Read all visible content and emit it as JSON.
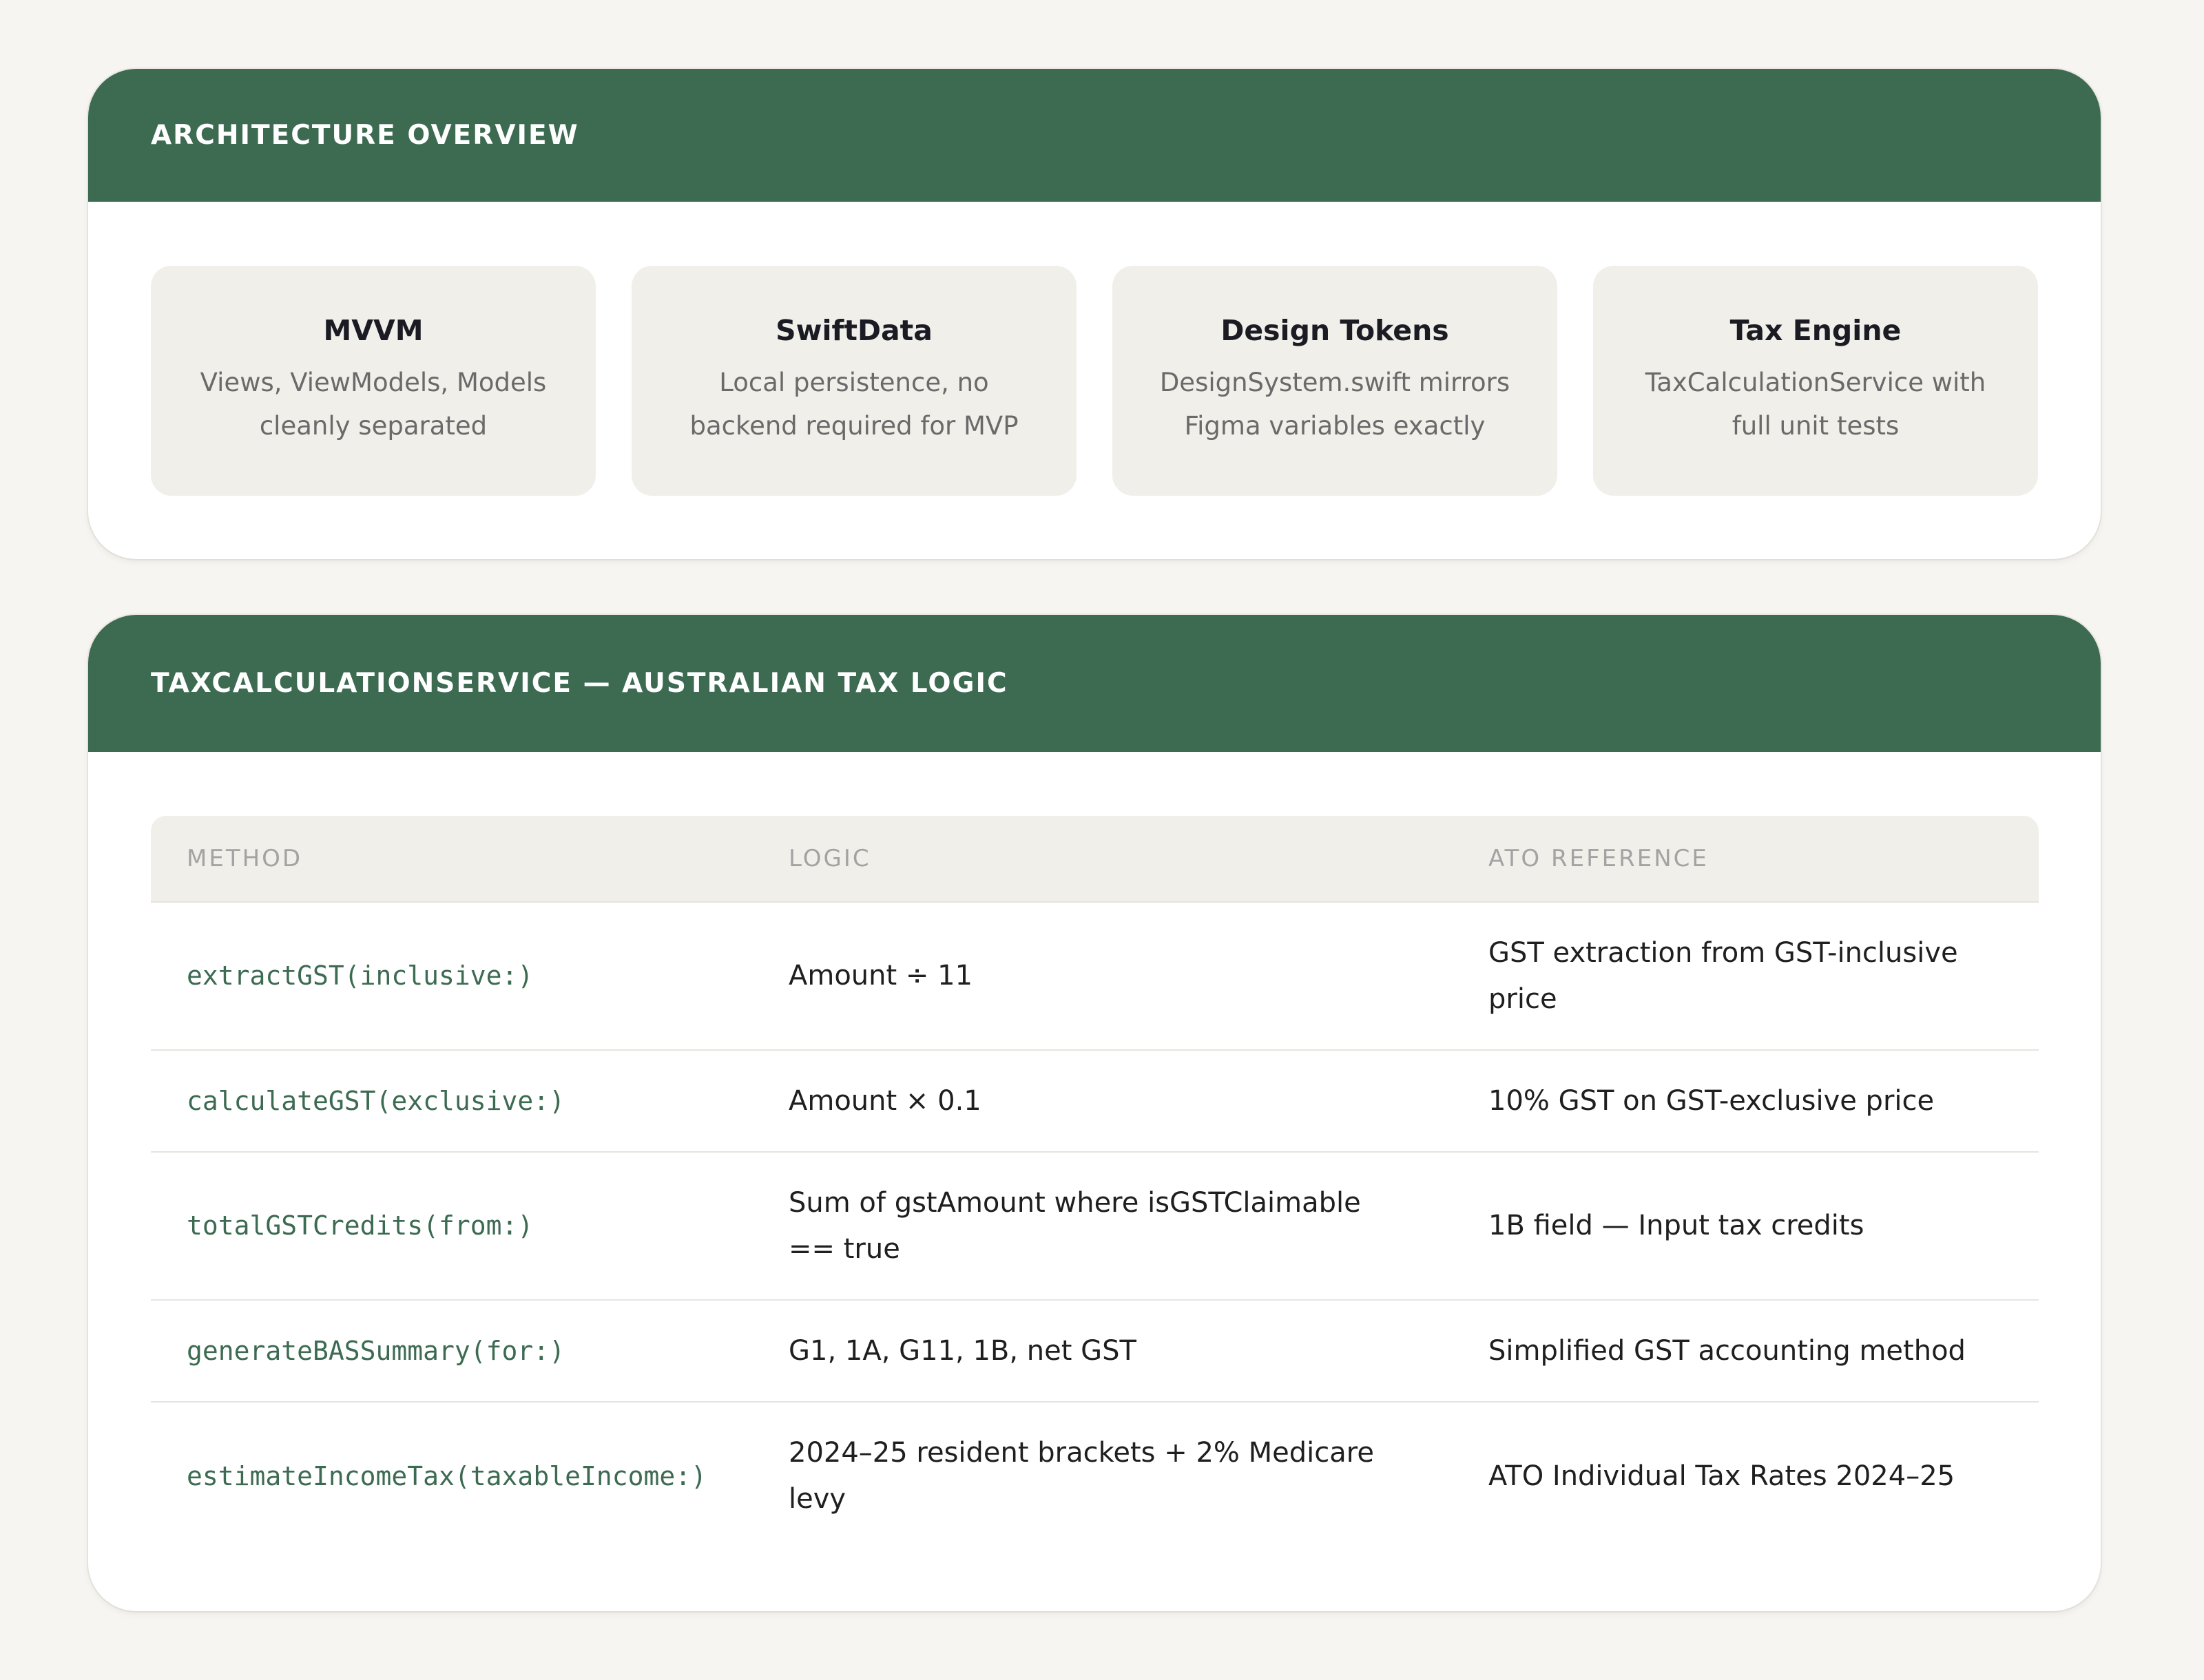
{
  "architecture": {
    "title": "ARCHITECTURE OVERVIEW",
    "tiles": [
      {
        "title": "MVVM",
        "desc": "Views, ViewModels, Models cleanly separated"
      },
      {
        "title": "SwiftData",
        "desc": "Local persistence, no backend required for MVP"
      },
      {
        "title": "Design Tokens",
        "desc": "DesignSystem.swift mirrors Figma variables exactly"
      },
      {
        "title": "Tax Engine",
        "desc": "TaxCalculationService with full unit tests"
      }
    ]
  },
  "tax_service": {
    "title": "TAXCALCULATIONSERVICE — AUSTRALIAN TAX LOGIC",
    "columns": [
      "METHOD",
      "LOGIC",
      "ATO REFERENCE"
    ],
    "rows": [
      {
        "method": "extractGST(inclusive:)",
        "logic": "Amount ÷ 11",
        "reference": "GST extraction from GST-inclusive price"
      },
      {
        "method": "calculateGST(exclusive:)",
        "logic": "Amount × 0.1",
        "reference": "10% GST on GST-exclusive price"
      },
      {
        "method": "totalGSTCredits(from:)",
        "logic": "Sum of gstAmount where isGSTClaimable == true",
        "reference": "1B field — Input tax credits"
      },
      {
        "method": "generateBASSummary(for:)",
        "logic": "G1, 1A, G11, 1B, net GST",
        "reference": "Simplified GST accounting method"
      },
      {
        "method": "estimateIncomeTax(taxableIncome:)",
        "logic": "2024–25 resident brackets + 2% Medicare levy",
        "reference": "ATO Individual Tax Rates 2024–25"
      }
    ]
  },
  "colors": {
    "header_green": "#3d6b52",
    "page_background": "#f7f5f1",
    "tile_background": "#f1efea"
  }
}
